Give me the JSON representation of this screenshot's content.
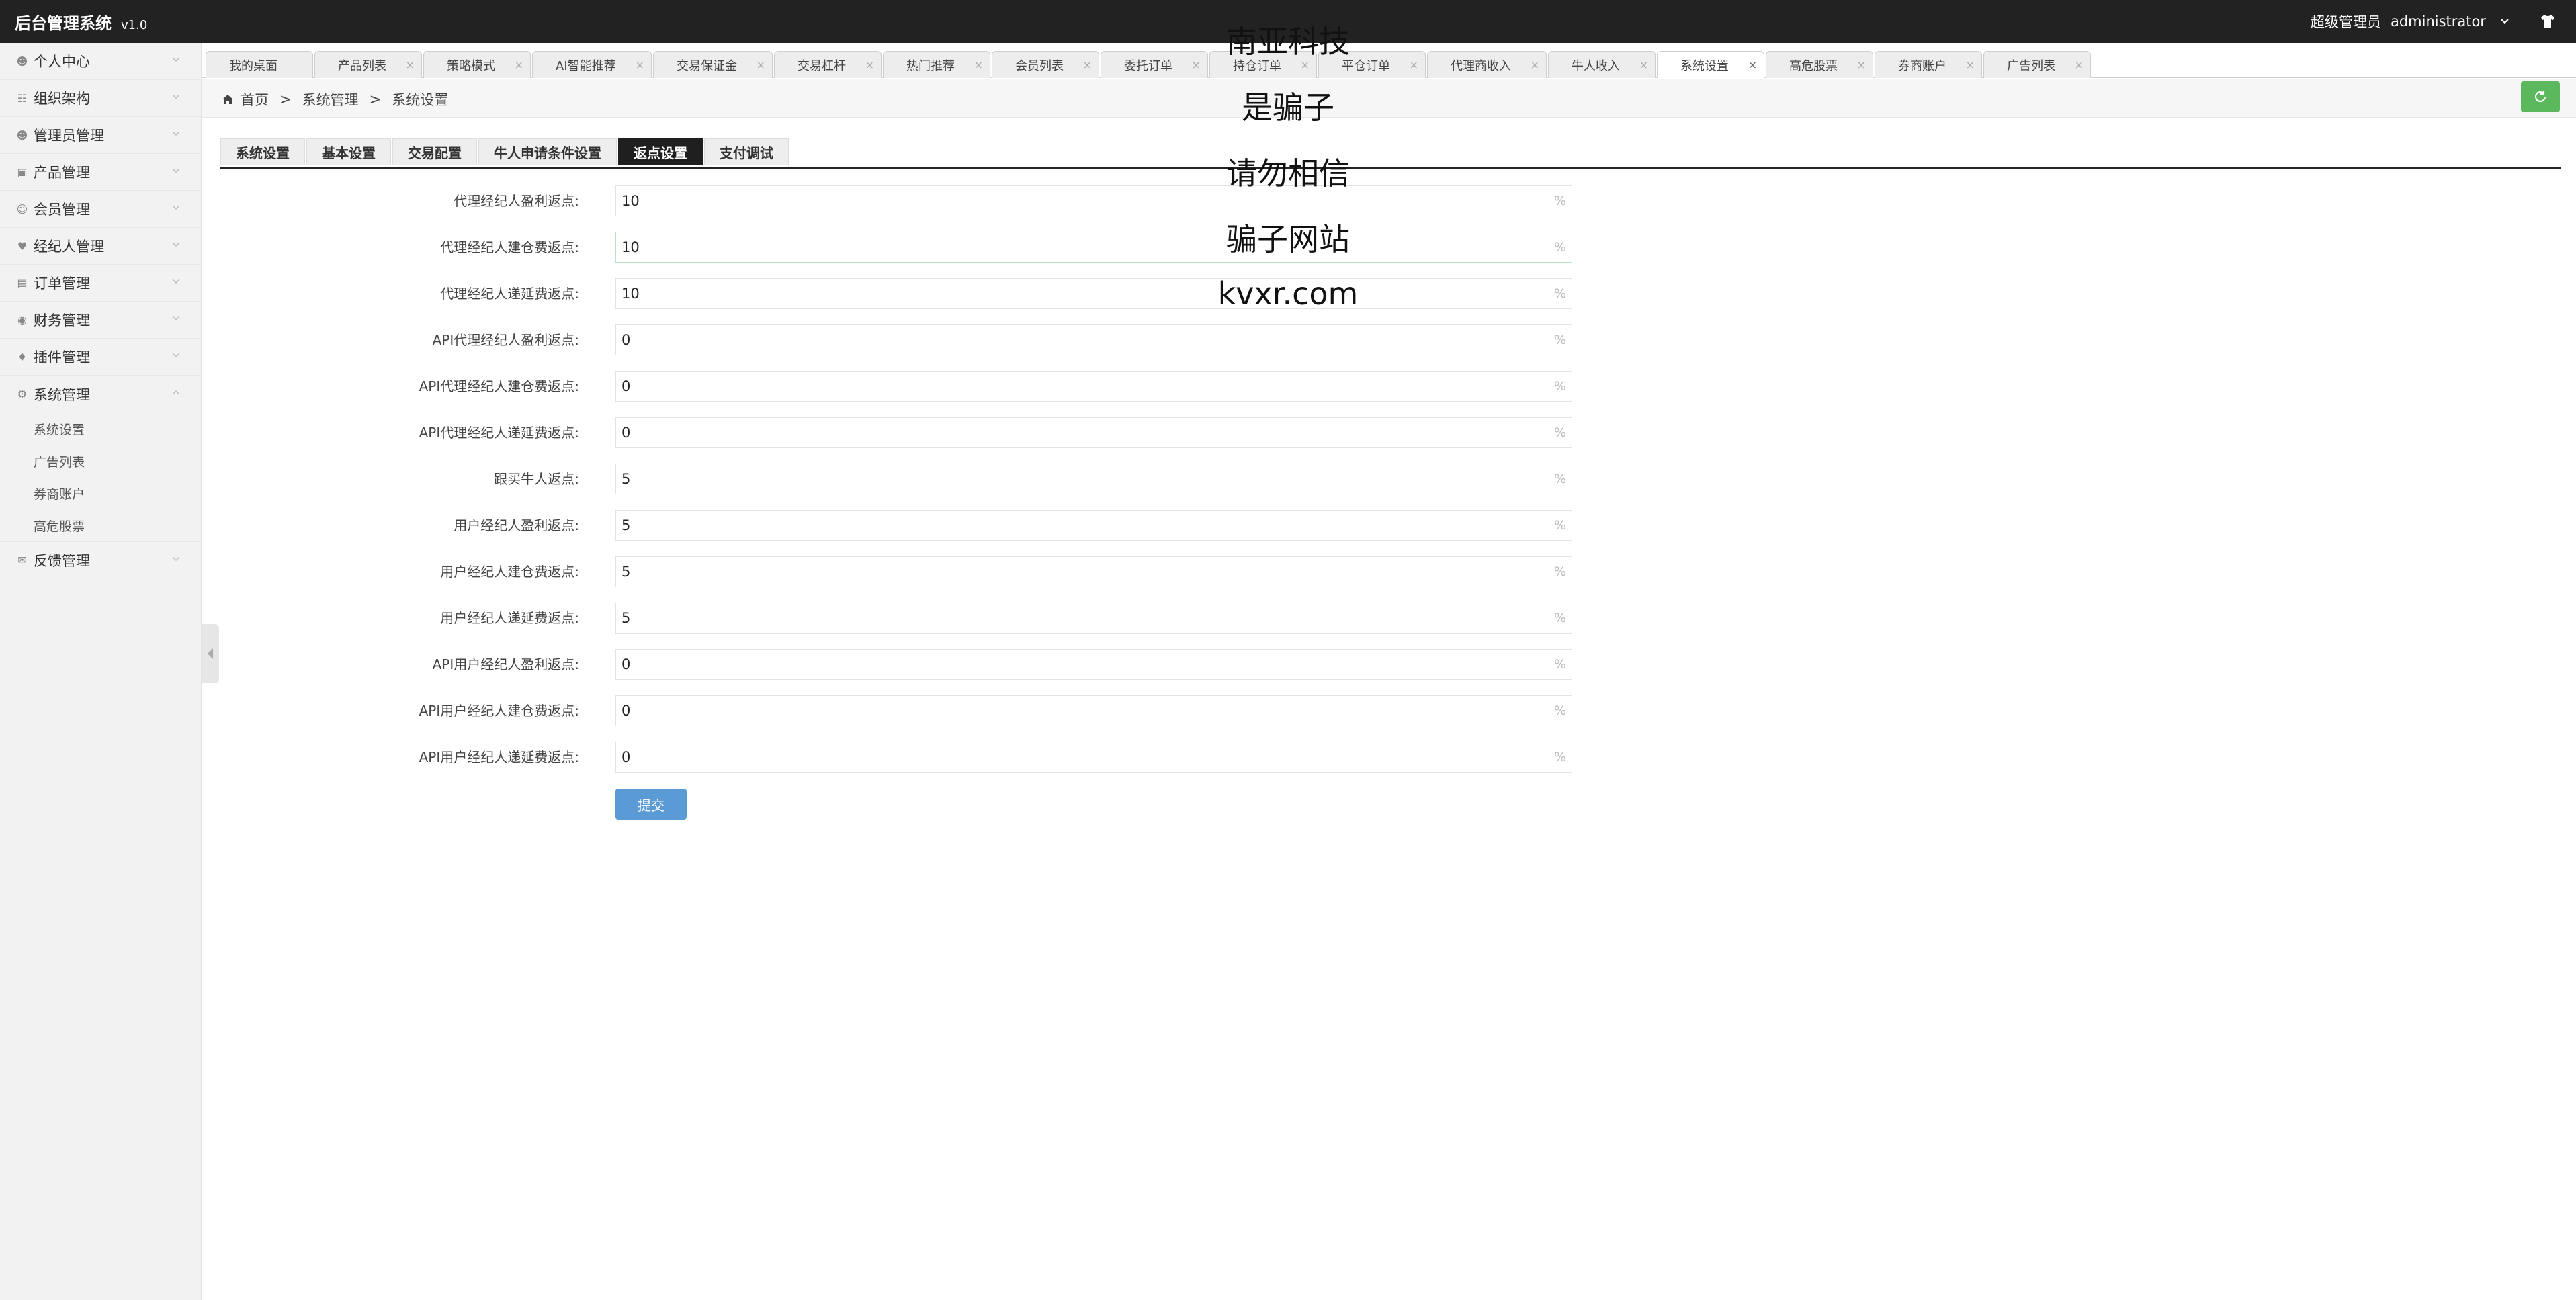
{
  "header": {
    "app_title": "后台管理系统",
    "version": "v1.0",
    "role": "超级管理员",
    "username": "administrator"
  },
  "sidebar": {
    "items": [
      {
        "label": "个人中心",
        "icon": "user-icon"
      },
      {
        "label": "组织架构",
        "icon": "org-icon"
      },
      {
        "label": "管理员管理",
        "icon": "user-icon"
      },
      {
        "label": "产品管理",
        "icon": "bag-icon"
      },
      {
        "label": "会员管理",
        "icon": "member-icon"
      },
      {
        "label": "经纪人管理",
        "icon": "broker-icon"
      },
      {
        "label": "订单管理",
        "icon": "order-icon"
      },
      {
        "label": "财务管理",
        "icon": "finance-icon"
      },
      {
        "label": "插件管理",
        "icon": "plugin-icon"
      },
      {
        "label": "系统管理",
        "icon": "gear-icon"
      }
    ],
    "sub_items": [
      "系统设置",
      "广告列表",
      "券商账户",
      "高危股票"
    ],
    "last_item": {
      "label": "反馈管理",
      "icon": "feedback-icon"
    }
  },
  "tabs": [
    {
      "label": "我的桌面"
    },
    {
      "label": "产品列表"
    },
    {
      "label": "策略模式"
    },
    {
      "label": "AI智能推荐"
    },
    {
      "label": "交易保证金"
    },
    {
      "label": "交易杠杆"
    },
    {
      "label": "热门推荐"
    },
    {
      "label": "会员列表"
    },
    {
      "label": "委托订单"
    },
    {
      "label": "持仓订单"
    },
    {
      "label": "平仓订单"
    },
    {
      "label": "代理商收入"
    },
    {
      "label": "牛人收入"
    },
    {
      "label": "系统设置"
    },
    {
      "label": "高危股票"
    },
    {
      "label": "券商账户"
    },
    {
      "label": "广告列表"
    }
  ],
  "breadcrumb": {
    "home": "首页",
    "sep": ">",
    "level1": "系统管理",
    "level2": "系统设置"
  },
  "subtabs": [
    "系统设置",
    "基本设置",
    "交易配置",
    "牛人申请条件设置",
    "返点设置",
    "支付调试"
  ],
  "active_subtab": "返点设置",
  "form": {
    "unit": "%",
    "fields": [
      {
        "label": "代理经纪人盈利返点:",
        "value": "10"
      },
      {
        "label": "代理经纪人建仓费返点:",
        "value": "10"
      },
      {
        "label": "代理经纪人递延费返点:",
        "value": "10"
      },
      {
        "label": "API代理经纪人盈利返点:",
        "value": "0"
      },
      {
        "label": "API代理经纪人建仓费返点:",
        "value": "0"
      },
      {
        "label": "API代理经纪人递延费返点:",
        "value": "0"
      },
      {
        "label": "跟买牛人返点:",
        "value": "5"
      },
      {
        "label": "用户经纪人盈利返点:",
        "value": "5"
      },
      {
        "label": "用户经纪人建仓费返点:",
        "value": "5"
      },
      {
        "label": "用户经纪人递延费返点:",
        "value": "5"
      },
      {
        "label": "API用户经纪人盈利返点:",
        "value": "0"
      },
      {
        "label": "API用户经纪人建仓费返点:",
        "value": "0"
      },
      {
        "label": "API用户经纪人递延费返点:",
        "value": "0"
      }
    ],
    "submit_label": "提交"
  },
  "overlay_text": [
    "南亚科技",
    "是骗子",
    "请勿相信",
    "骗子网站",
    "kvxr.com"
  ],
  "colors": {
    "header_bg": "#222222",
    "sidebar_bg": "#f2f2f2",
    "active_subtab_bg": "#1f1f1f",
    "submit_bg": "#5b9bd5",
    "refresh_bg": "#5cb85c"
  }
}
